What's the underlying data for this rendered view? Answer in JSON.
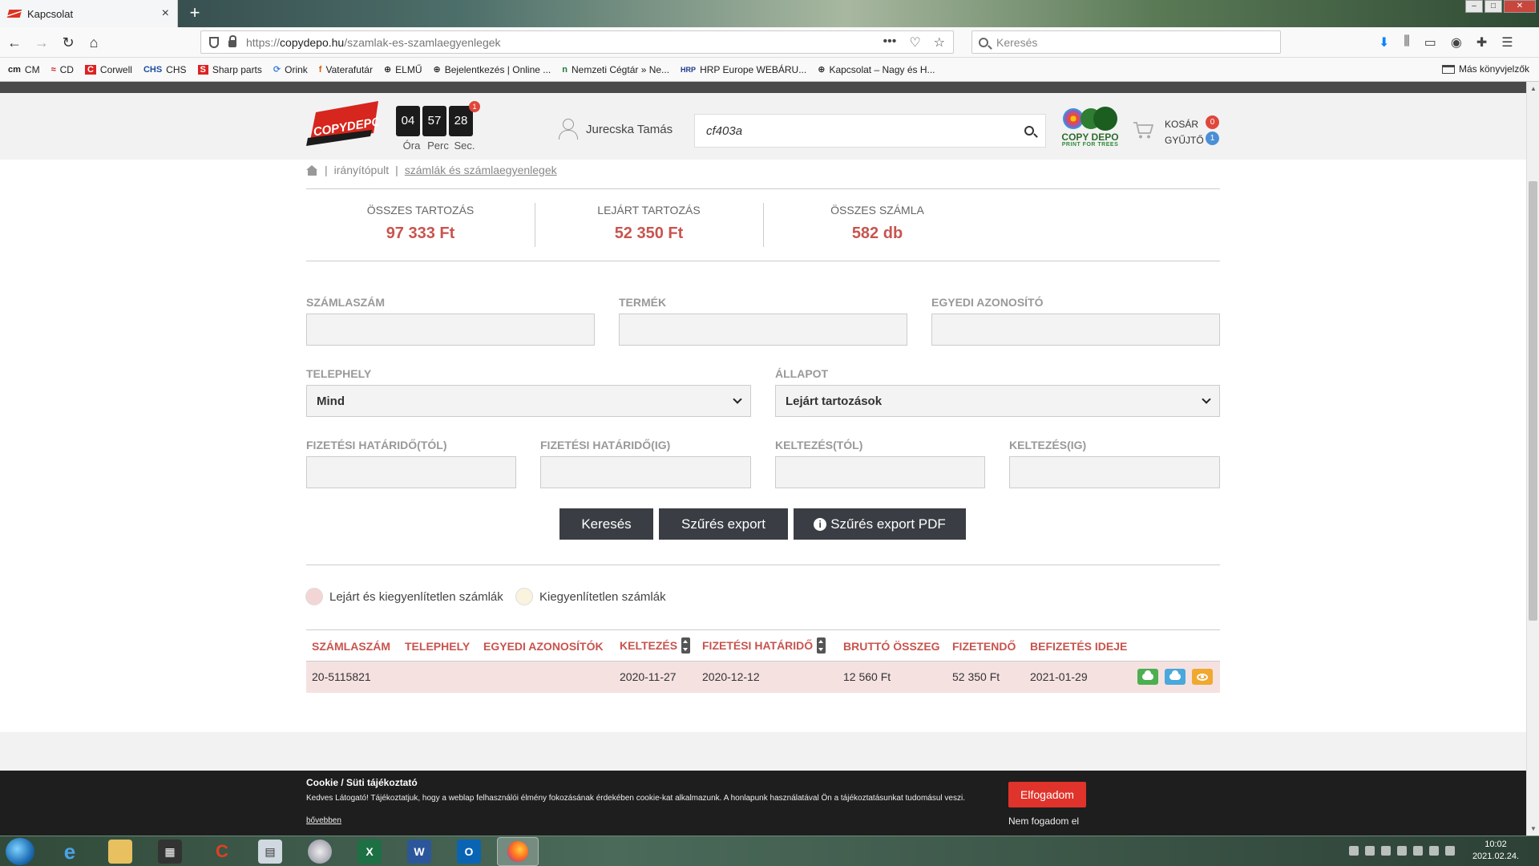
{
  "browser": {
    "tab_title": "Kapcsolat",
    "url_proto": "https://",
    "url_host": "copydepo.hu",
    "url_path": "/szamlak-es-szamlaegyenlegek",
    "search_placeholder": "Keresés",
    "bookmarks": [
      "CM",
      "CD",
      "Corwell",
      "CHS",
      "Sharp parts",
      "Orink",
      "Vaterafutár",
      "ELMŰ",
      "Bejelentkezés | Online ...",
      "Nemzeti Cégtár » Ne...",
      "HRP Europe WEBÁRU...",
      "Kapcsolat – Nagy és H..."
    ],
    "other_bookmarks": "Más könyvjelzők"
  },
  "header": {
    "logo_text": "COPYDEPO",
    "timer": {
      "hours": "04",
      "minutes": "57",
      "seconds": "28",
      "badge": "1",
      "label_h": "Óra",
      "label_m": "Perc",
      "label_s": "Sec."
    },
    "user_name": "Jurecska Tamás",
    "search_value": "cf403a",
    "green_logo_line1": "COPY DEPO",
    "green_logo_line2": "PRINT FOR TREES",
    "cart_label": "KOSÁR",
    "cart_count": "0",
    "collector_label": "GYŰJTŐ",
    "collector_count": "1"
  },
  "breadcrumb": {
    "sep": "|",
    "item1": "irányítópult",
    "item2": "számlák és számlaegyenlegek"
  },
  "stats": [
    {
      "label": "ÖSSZES TARTOZÁS",
      "value": "97 333 Ft"
    },
    {
      "label": "LEJÁRT TARTOZÁS",
      "value": "52 350 Ft"
    },
    {
      "label": "ÖSSZES SZÁMLA",
      "value": "582 db"
    }
  ],
  "form": {
    "invoice_no_label": "SZÁMLASZÁM",
    "product_label": "TERMÉK",
    "custom_id_label": "EGYEDI AZONOSÍTÓ",
    "site_label": "TELEPHELY",
    "site_value": "Mind",
    "status_label": "ÁLLAPOT",
    "status_value": "Lejárt tartozások",
    "due_from_label": "FIZETÉSI HATÁRIDŐ(TÓL)",
    "due_to_label": "FIZETÉSI HATÁRIDŐ(IG)",
    "date_from_label": "KELTEZÉS(TÓL)",
    "date_to_label": "KELTEZÉS(IG)"
  },
  "buttons": {
    "search": "Keresés",
    "export": "Szűrés export",
    "export_pdf": "Szűrés export PDF"
  },
  "legend": {
    "overdue": "Lejárt és kiegyenlítetlen számlák",
    "unpaid": "Kiegyenlítetlen számlák",
    "overdue_color": "#f3d5d5",
    "unpaid_color": "#faf3dd"
  },
  "table": {
    "headers": [
      "SZÁMLASZÁM",
      "TELEPHELY",
      "EGYEDI AZONOSÍTÓK",
      "KELTEZÉS",
      "FIZETÉSI HATÁRIDŐ",
      "BRUTTÓ ÖSSZEG",
      "FIZETENDŐ",
      "BEFIZETÉS IDEJE"
    ],
    "rows": [
      {
        "invoice": "20-5115821",
        "site": "",
        "custom_id": "",
        "date": "2020-11-27",
        "due": "2020-12-12",
        "gross": "12 560 Ft",
        "payable": "52 350 Ft",
        "paid_at": "2021-01-29"
      }
    ]
  },
  "cookie": {
    "title": "Cookie / Süti tájékoztató",
    "body": "Kedves Látogató! Tájékoztatjuk, hogy a weblap felhasználói élmény fokozásának érdekében cookie-kat alkalmazunk. A honlapunk használatával Ön a tájékoztatásunkat tudomásul veszi.",
    "more": "bővebben",
    "accept": "Elfogadom",
    "reject": "Nem fogadom el"
  },
  "taskbar": {
    "time": "10:02",
    "date": "2021.02.24."
  },
  "colors": {
    "accent_red": "#c8544f",
    "button_dark": "#3a3e44",
    "row_overdue": "#f6e1e1"
  }
}
